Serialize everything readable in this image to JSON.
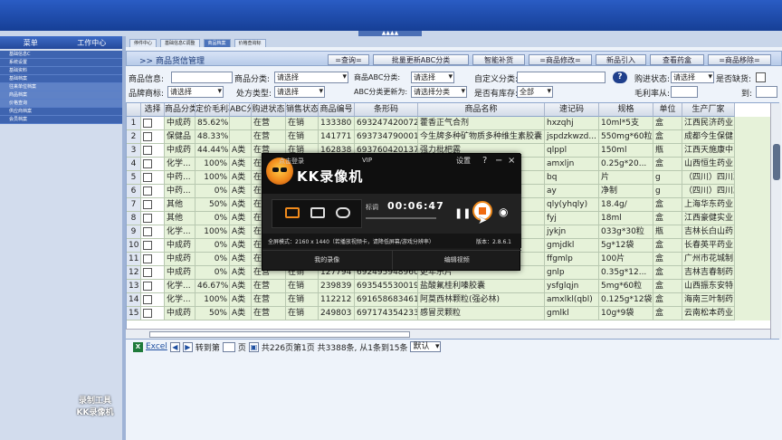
{
  "banner": {
    "collapse_tab": "▲▲▲▲"
  },
  "sidebar": {
    "header_menu": "菜单",
    "header_work": "工作中心",
    "items": [
      "基础信息C",
      "系统设置",
      "基础资料",
      "基础档案",
      "往来单位档案",
      "商品档案",
      "价格查询",
      "供应商档案",
      "会员档案"
    ]
  },
  "tabs": [
    "停件中心",
    "基础信息C调整",
    "商品档案",
    "价格查询标"
  ],
  "page": {
    "title": ">>  商品货信管理",
    "toolbar": [
      "=查询=",
      "批量更新ABC分类",
      "智能补货",
      "=商品修改=",
      "新品引入",
      "查看药盒",
      "=商品移除="
    ]
  },
  "filters": {
    "product_info_label": "商品信息:",
    "category_label": "商品分类:",
    "category_value": "请选择",
    "abc_label": "商品ABC分类:",
    "abc_value": "请选择",
    "custom_label": "自定义分类:",
    "help": "?",
    "purchase_status_label": "购进状态:",
    "purchase_status_value": "请选择",
    "out_of_stock_label": "是否缺货:",
    "brand_label": "品牌商标:",
    "brand_value": "请选择",
    "rx_label": "处方类型:",
    "rx_value": "请选择",
    "abc_update_label": "ABC分类更新为:",
    "abc_update_value": "请选择分类",
    "has_stock_label": "是否有库存:",
    "has_stock_value": "全部",
    "margin_label": "毛利率从:",
    "margin_to": "到:"
  },
  "grid": {
    "columns": [
      "",
      "选择",
      "商品分类",
      "定价毛利率",
      "ABC分类",
      "购进状态",
      "销售状态",
      "商品编号",
      "条形码",
      "商品名称",
      "速记码",
      "规格",
      "单位",
      "生产厂家"
    ],
    "rows": [
      [
        "1",
        "中成药",
        "85.62%",
        "",
        "在营",
        "在销",
        "133380",
        "6932474200720",
        "藿香正气合剂",
        "hxzqhj",
        "10ml*5支",
        "盒",
        "江西民济药业..."
      ],
      [
        "2",
        "保健品",
        "48.33%",
        "",
        "在营",
        "在销",
        "141771",
        "6937347900011",
        "今生牌多种矿物质多种维生素胶囊",
        "jspdzkwzd...",
        "550mg*60粒",
        "盒",
        "成都今生保健..."
      ],
      [
        "3",
        "中成药",
        "44.44%",
        "A类",
        "在营",
        "在销",
        "162838",
        "6937604201377",
        "强力枇杷露",
        "qlppl",
        "150ml",
        "瓶",
        "江西天施康中..."
      ],
      [
        "4",
        "化学...",
        "100%",
        "A类",
        "在营",
        "在销",
        "",
        "",
        "",
        "amxljn",
        "0.25g*20...",
        "盒",
        "山西恒生药业..."
      ],
      [
        "5",
        "中药...",
        "100%",
        "A类",
        "在营",
        "在销",
        "",
        "",
        "",
        "bq",
        "片",
        "g",
        "（四川）四川冀..."
      ],
      [
        "6",
        "中药...",
        "0%",
        "A类",
        "在营",
        "在销",
        "",
        "",
        "",
        "ay",
        "净制",
        "g",
        "（四川）四川冀..."
      ],
      [
        "7",
        "其他",
        "50%",
        "A类",
        "在营",
        "在销",
        "",
        "",
        "",
        "qly(yhqly)",
        "18.4g/",
        "盒",
        "上海华东药业..."
      ],
      [
        "8",
        "其他",
        "0%",
        "A类",
        "在营",
        "在销",
        "",
        "",
        "",
        "fyj",
        "18ml",
        "盒",
        "江西豪健实业..."
      ],
      [
        "9",
        "化学...",
        "100%",
        "A类",
        "在营",
        "在销",
        "",
        "",
        "",
        "jykjn",
        "033g*30粒",
        "瓶",
        "吉林长白山药..."
      ],
      [
        "10",
        "中成药",
        "0%",
        "A类",
        "在营",
        "在销",
        "",
        "",
        "",
        "gmjdkl",
        "5g*12袋",
        "盒",
        "长春英平药业..."
      ],
      [
        "11",
        "中成药",
        "0%",
        "A类",
        "在营",
        "在销",
        "",
        "",
        "",
        "ffgmlp",
        "100片",
        "盒",
        "广州市花城制..."
      ],
      [
        "12",
        "中成药",
        "0%",
        "A类",
        "在营",
        "在销",
        "127794",
        "6924959489607",
        "更年乐片",
        "gnlp",
        "0.35g*12...",
        "盒",
        "吉林吉春制药..."
      ],
      [
        "13",
        "化学...",
        "46.67%",
        "A类",
        "在营",
        "在销",
        "239839",
        "6935455300198",
        "盐酸氟桂利嗪胶囊",
        "ysfglqjn",
        "5mg*60粒",
        "盒",
        "山西振东安特..."
      ],
      [
        "14",
        "化学...",
        "100%",
        "A类",
        "在营",
        "在销",
        "112212",
        "6916586834615",
        "阿莫西林颗粒(强必林)",
        "amxlkl(qbl)",
        "0.125g*12袋",
        "盒",
        "海南三叶制药..."
      ],
      [
        "15",
        "中成药",
        "50%",
        "A类",
        "在营",
        "在销",
        "249803",
        "6971743542338",
        "感冒灵颗粒",
        "gmlkl",
        "10g*9袋",
        "盒",
        "云南松本药业..."
      ]
    ]
  },
  "pager": {
    "excel": "Excel",
    "goto": "转到第",
    "page_unit": "页",
    "summary": "共226页第1页  共3388条, 从1条到15条",
    "sort_value": "默认"
  },
  "recorder": {
    "login": "点击登录",
    "vip": "VIP",
    "settings": "设置",
    "help": "?",
    "minimize": "−",
    "close": "×",
    "app_name": "KK录像机",
    "mic_label": "标调",
    "timer": "00:06:47",
    "info_left": "全屏模式：2160 x 1440（若播放视频卡，请降低屏幕/游戏分辨率）",
    "version": "版本：2.8.6.1",
    "my_recordings": "我的录像",
    "edit_video": "编辑视频"
  },
  "watermark": {
    "line1": "录制工具",
    "line2": "KK录像机"
  }
}
